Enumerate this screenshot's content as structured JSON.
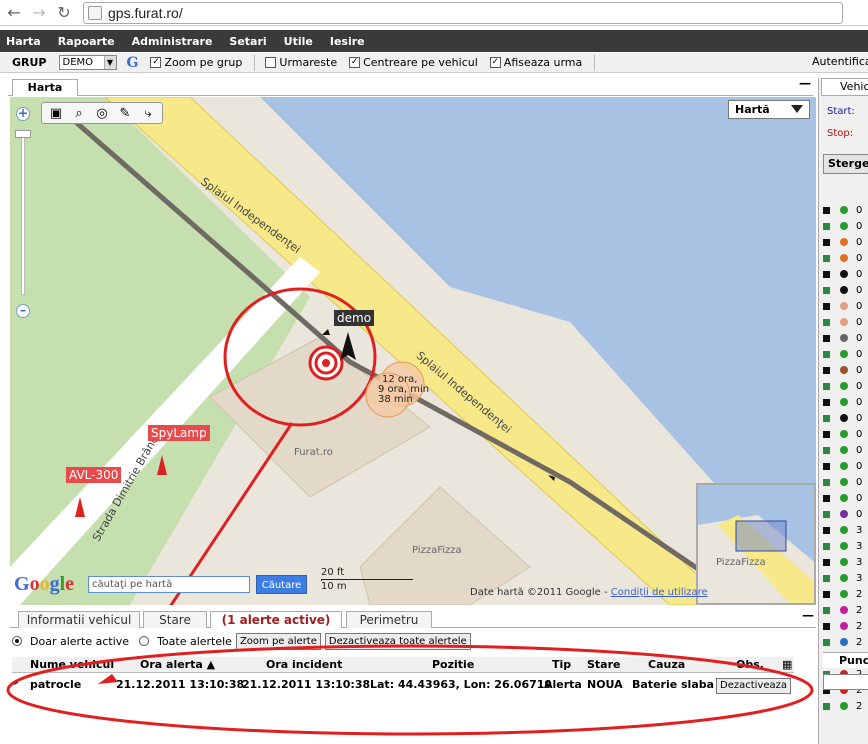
{
  "browser": {
    "url": "gps.furat.ro/"
  },
  "menu": [
    "Harta",
    "Rapoarte",
    "Administrare",
    "Setari",
    "Utile",
    "Iesire"
  ],
  "toolbar": {
    "group_label": "GRUP",
    "group_value": "DEMO",
    "zoom_group": "Zoom pe grup",
    "follow": "Urmareste",
    "center": "Centreare pe vehicul",
    "trail": "Afiseaza urma",
    "auth": "Autentifica"
  },
  "map": {
    "tab": "Harta",
    "type_select": "Hartă",
    "streets": {
      "splai_top": "Splaiul Independenţei",
      "splai_bottom": "Splaiul Independenţei",
      "dimitrie": "Strada Dimitrie Brândză"
    },
    "pois": {
      "furat": "Furat.ro",
      "pizza": "PizzaFizza",
      "pizza_small": "PizzaFizza"
    },
    "vehicles": {
      "demo": "demo",
      "spylamp": "SpyLamp",
      "avl": "AVL-300"
    },
    "time_badge": {
      "line1": "12 ora,",
      "line2": "9 ora, min",
      "line3": "38 min"
    },
    "search_placeholder": "căutaţi pe hartă",
    "search_button": "Căutare",
    "scale_ft": "20 ft",
    "scale_m": "10 m",
    "copyright": "Date hartă ©2011 Google -",
    "terms": "Condiţii de utilizare",
    "google": "Google"
  },
  "bottom": {
    "tabs": [
      "Informatii vehicul",
      "Stare",
      "(1 alerte active)",
      "Perimetru"
    ],
    "filter_active": "Doar alerte active",
    "filter_all": "Toate alertele",
    "btn_zoom": "Zoom pe alerte",
    "btn_deactivate_all": "Dezactiveaza toate alertele",
    "columns": [
      "Nume vehicul",
      "Ora alerta ▲",
      "Ora incident",
      "Pozitie",
      "Tip",
      "Stare",
      "Cauza",
      "Obs."
    ],
    "row": {
      "vehicle": "patrocle",
      "alert_time": "21.12.2011 13:10:38",
      "incident_time": "21.12.2011 13:10:38",
      "position": "Lat: 44.43963, Lon: 26.06719",
      "type": "Alerta",
      "state": "NOUA",
      "cause": "Baterie slaba",
      "action": "Dezactiveaza"
    }
  },
  "right": {
    "tab": "Vehic",
    "start": "Start:",
    "stop": "Stop:",
    "clear": "Sterge",
    "points": "Punc",
    "vehicle_rows": [
      "0",
      "0",
      "0",
      "0",
      "0",
      "0",
      "0",
      "0",
      "0",
      "0",
      "0",
      "0",
      "0",
      "0",
      "0",
      "0",
      "0",
      "0",
      "0",
      "0",
      "3",
      "3",
      "3",
      "3",
      "2",
      "2",
      "2",
      "2",
      "2",
      "2",
      "2",
      "2"
    ]
  },
  "colors": {
    "water": "#a8c2e4",
    "road": "#f7e98a",
    "park": "#c5dfae",
    "alert": "#e02020"
  }
}
